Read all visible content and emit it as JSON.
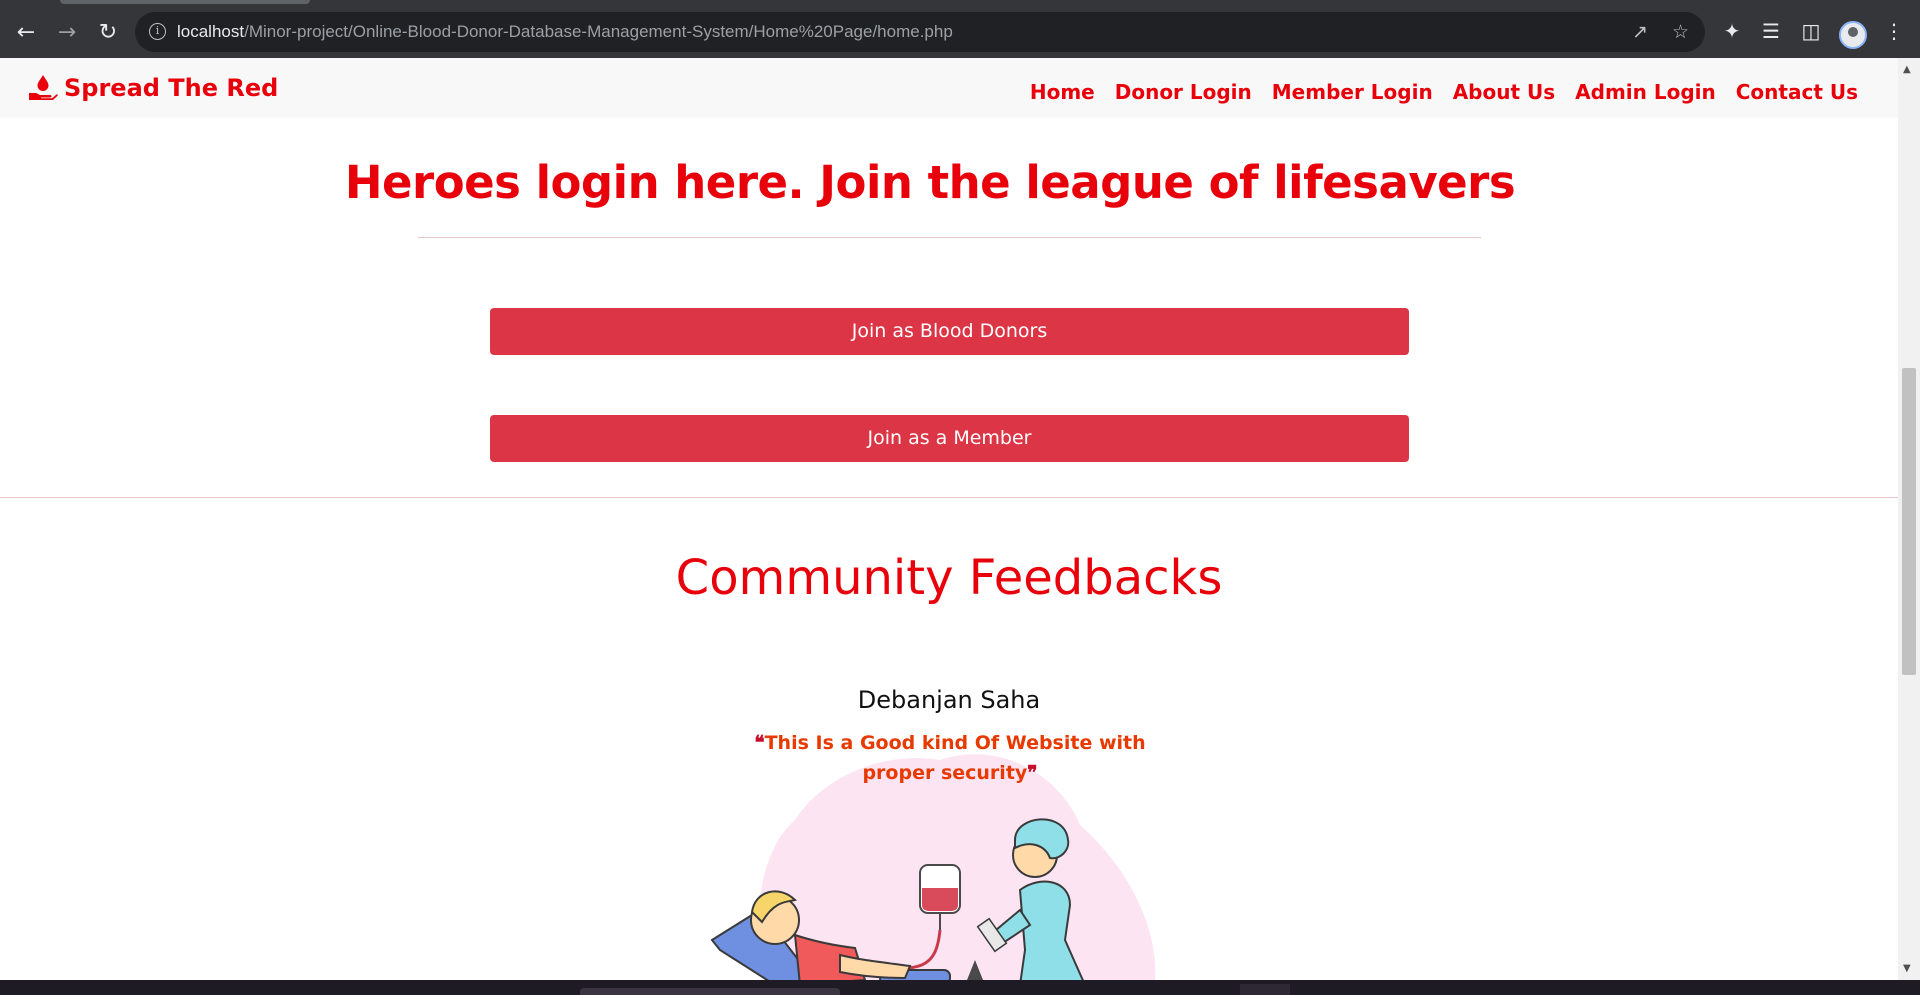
{
  "browser": {
    "url_host": "localhost",
    "url_path": "/Minor-project/Online-Blood-Donor-Database-Management-System/Home%20Page/home.php",
    "icons": [
      "back-arrow-icon",
      "forward-arrow-icon",
      "reload-icon",
      "site-info-icon",
      "share-icon",
      "bookmark-star-icon",
      "extensions-icon",
      "media-icon",
      "side-panel-icon",
      "profile-avatar",
      "menu-dots-icon"
    ]
  },
  "site": {
    "brand": "Spread The Red",
    "nav": [
      "Home",
      "Donor Login",
      "Member Login",
      "About Us",
      "Admin Login",
      "Contact Us"
    ]
  },
  "hero": {
    "title": "Heroes login here. Join the league of lifesavers",
    "donor_button": "Join as Blood Donors",
    "member_button": "Join as a Member"
  },
  "feedback": {
    "title": "Community Feedbacks",
    "name": "Debanjan Saha",
    "quote": "This Is a Good kind Of Website with proper security"
  },
  "colors": {
    "brand_red": "#e8000b",
    "button_red": "#dc3545",
    "quote_orange": "#e83a00"
  }
}
